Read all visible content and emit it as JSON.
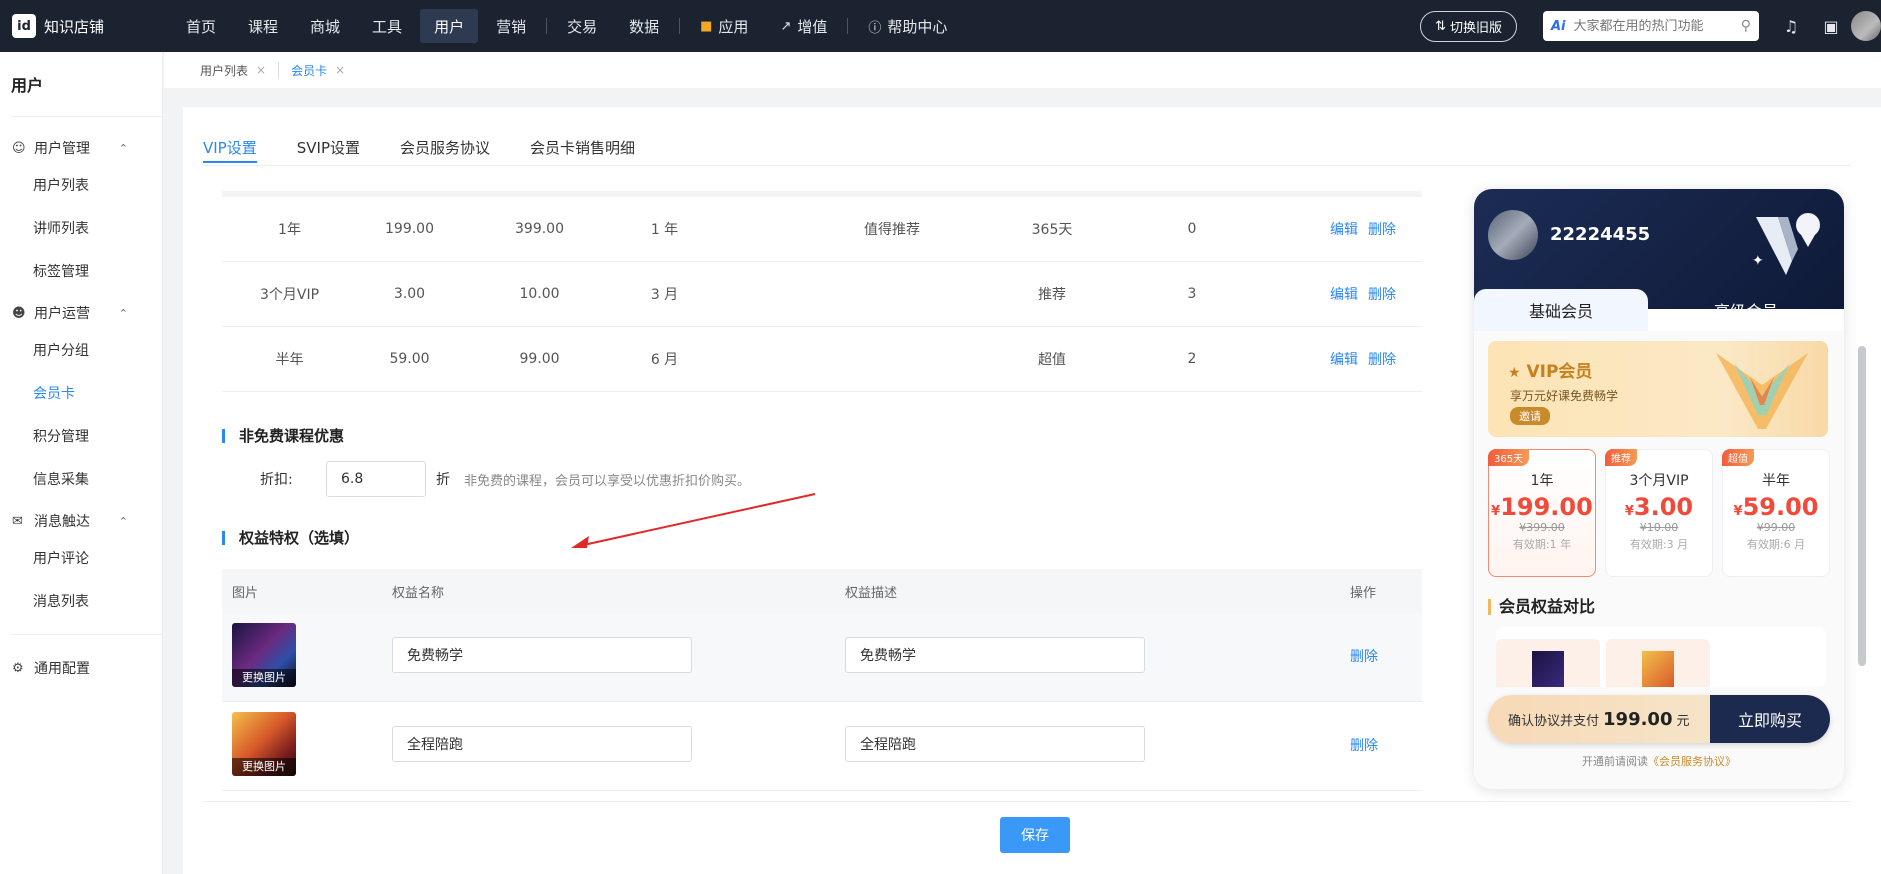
{
  "brand": {
    "name": "知识店铺",
    "logo_text": "id"
  },
  "nav": {
    "items": [
      {
        "label": "首页"
      },
      {
        "label": "课程"
      },
      {
        "label": "商城"
      },
      {
        "label": "工具"
      },
      {
        "label": "用户",
        "active": true
      },
      {
        "label": "营销"
      }
    ],
    "items2": [
      {
        "label": "交易"
      },
      {
        "label": "数据"
      }
    ],
    "apps": "应用",
    "value_added": "增值",
    "help": "帮助中心",
    "switch_label": "切换旧版",
    "search_placeholder": "大家都在用的热门功能",
    "search_ai": "Ai"
  },
  "sidebar": {
    "title": "用户",
    "groups": [
      {
        "label": "用户管理",
        "items": [
          "用户列表",
          "讲师列表",
          "标签管理"
        ]
      },
      {
        "label": "用户运营",
        "items": [
          "用户分组",
          "会员卡",
          "积分管理",
          "信息采集"
        ]
      },
      {
        "label": "消息触达",
        "items": [
          "用户评论",
          "消息列表"
        ]
      }
    ],
    "settings": "通用配置"
  },
  "tagsbar": {
    "tags": [
      "用户列表",
      "会员卡"
    ]
  },
  "tabs": [
    "VIP设置",
    "SVIP设置",
    "会员服务协议",
    "会员卡销售明细"
  ],
  "plans_table": {
    "rows": [
      {
        "name": "1年",
        "price": "199.00",
        "orig": "399.00",
        "period": "1 年",
        "tag": "值得推荐",
        "days": "365天",
        "sort": "0"
      },
      {
        "name": "3个月VIP",
        "price": "3.00",
        "orig": "10.00",
        "period": "3 月",
        "tag": "",
        "days": "推荐",
        "sort": "3"
      },
      {
        "name": "半年",
        "price": "59.00",
        "orig": "99.00",
        "period": "6 月",
        "tag": "",
        "days": "超值",
        "sort": "2"
      }
    ],
    "edit_label": "编辑",
    "delete_label": "删除"
  },
  "discount": {
    "title": "非免费课程优惠",
    "label": "折扣:",
    "value": "6.8",
    "unit": "折",
    "hint": "非免费的课程，会员可以享受以优惠折扣价购买。"
  },
  "rights": {
    "title": "权益特权（选填）",
    "headers": [
      "图片",
      "权益名称",
      "权益描述",
      "操作"
    ],
    "rows": [
      {
        "name": "免费畅学",
        "desc": "免费畅学",
        "img_caption": "更换图片"
      },
      {
        "name": "全程陪跑",
        "desc": "全程陪跑",
        "img_caption": "更换图片"
      }
    ],
    "delete_label": "删除"
  },
  "save_label": "保存",
  "preview": {
    "username": "22224455",
    "tab_basic": "基础会员",
    "tab_advanced": "高级会员",
    "vip_title": "VIP会员",
    "vip_sub": "享万元好课免费畅学",
    "vip_invite": "邀请",
    "currency": "¥",
    "plans": [
      {
        "badge": "365天",
        "name": "1年",
        "price": "199.00",
        "orig": "¥399.00",
        "valid": "有效期:1 年"
      },
      {
        "badge": "推荐",
        "name": "3个月VIP",
        "price": "3.00",
        "orig": "¥10.00",
        "valid": "有效期:3 月"
      },
      {
        "badge": "超值",
        "name": "半年",
        "price": "59.00",
        "orig": "¥99.00",
        "valid": "有效期:6 月"
      }
    ],
    "rights_title": "会员权益对比",
    "buy_prefix": "确认协议并支付",
    "buy_amount": "199.00",
    "buy_unit": "元",
    "buy_button": "立即购买",
    "agree_prefix": "开通前请阅读",
    "agree_link": "《会员服务协议》"
  }
}
